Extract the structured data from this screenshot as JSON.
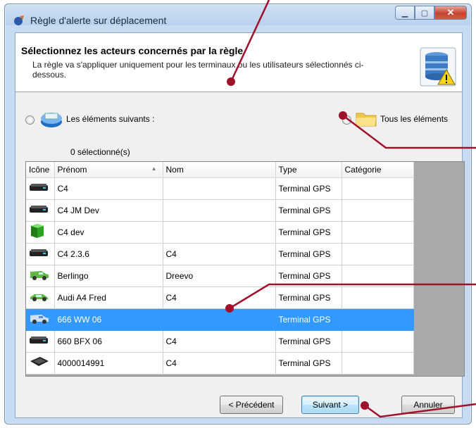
{
  "window": {
    "title": "Règle d'alerte sur déplacement"
  },
  "header": {
    "title": "Sélectionnez les acteurs concernés par la règle",
    "description": "La règle va s'appliquer uniquement pour les terminaux ou les utilisateurs sélectionnés ci-dessous."
  },
  "options": {
    "following_label": "Les éléments suivants :",
    "all_label": "Tous les éléments",
    "selected_count": "0 sélectionné(s)"
  },
  "table": {
    "columns": [
      "Icône",
      "Prénom",
      "Nom",
      "Type",
      "Catégorie"
    ],
    "rows": [
      {
        "icon": "gps-terminal-icon",
        "prenom": "C4",
        "nom": "",
        "type": "Terminal GPS",
        "categorie": ""
      },
      {
        "icon": "gps-terminal-icon",
        "prenom": "C4 JM Dev",
        "nom": "",
        "type": "Terminal GPS",
        "categorie": ""
      },
      {
        "icon": "green-box-icon",
        "prenom": "C4 dev",
        "nom": "",
        "type": "Terminal GPS",
        "categorie": ""
      },
      {
        "icon": "gps-terminal-icon",
        "prenom": "C4 2.3.6",
        "nom": "C4",
        "type": "Terminal GPS",
        "categorie": ""
      },
      {
        "icon": "green-van-icon",
        "prenom": "Berlingo",
        "nom": "Dreevo",
        "type": "Terminal GPS",
        "categorie": ""
      },
      {
        "icon": "green-car-icon",
        "prenom": "Audi A4 Fred",
        "nom": "C4",
        "type": "Terminal GPS",
        "categorie": ""
      },
      {
        "icon": "blue-van-icon",
        "prenom": "666 WW 06",
        "nom": "",
        "type": "Terminal GPS",
        "categorie": "",
        "selected": true
      },
      {
        "icon": "gps-terminal-icon",
        "prenom": "660 BFX 06",
        "nom": "C4",
        "type": "Terminal GPS",
        "categorie": ""
      },
      {
        "icon": "gps-device-icon",
        "prenom": "4000014991",
        "nom": "C4",
        "type": "Terminal GPS",
        "categorie": ""
      }
    ]
  },
  "buttons": {
    "previous": "< Précédent",
    "next": "Suivant >",
    "cancel": "Annuler"
  },
  "colors": {
    "selection": "#3399ff",
    "annotation": "#a0102a"
  }
}
